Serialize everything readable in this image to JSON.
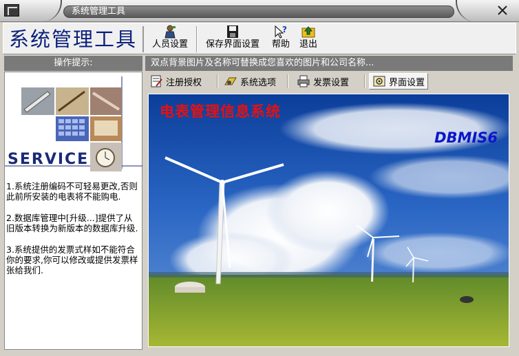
{
  "window": {
    "title": "系统管理工具",
    "close_icon": "close-x-icon"
  },
  "toolbar": {
    "logo_text": "系统管理工具",
    "buttons": [
      {
        "label": "人员设置",
        "icon": "user-settings-icon"
      },
      {
        "label": "保存界面设置",
        "icon": "save-disk-icon"
      },
      {
        "label": "帮助",
        "icon": "help-question-icon"
      },
      {
        "label": "退出",
        "icon": "exit-arrow-icon"
      }
    ]
  },
  "left": {
    "header": "操作提示:",
    "service_text": "SERVICE",
    "tips": [
      "1.系统注册编码不可轻易更改,否则此前所安装的电表将不能购电.",
      "2.数据库管理中[升级...]提供了从旧版本转换为新版本的数据库升级.",
      "3.系统提供的发票式样如不能符合你的要求,你可以修改或提供发票样张给我们."
    ]
  },
  "main": {
    "hint": "双点背景图片及名称可替换成您喜欢的图片和公司名称...",
    "tabs": [
      {
        "label": "注册授权",
        "icon": "register-icon"
      },
      {
        "label": "系统选项",
        "icon": "options-icon"
      },
      {
        "label": "发票设置",
        "icon": "printer-icon"
      },
      {
        "label": "界面设置",
        "icon": "interface-icon"
      }
    ],
    "active_tab": "界面设置",
    "banner_title": "电表管理信息系统",
    "banner_brand": "DBMIS6"
  },
  "colors": {
    "panel_header": "#7a7a7a",
    "logo_text": "#0a1f7a",
    "banner_title": "#e81010",
    "banner_brand": "#0a16c8",
    "service_text": "#1b2a78"
  }
}
